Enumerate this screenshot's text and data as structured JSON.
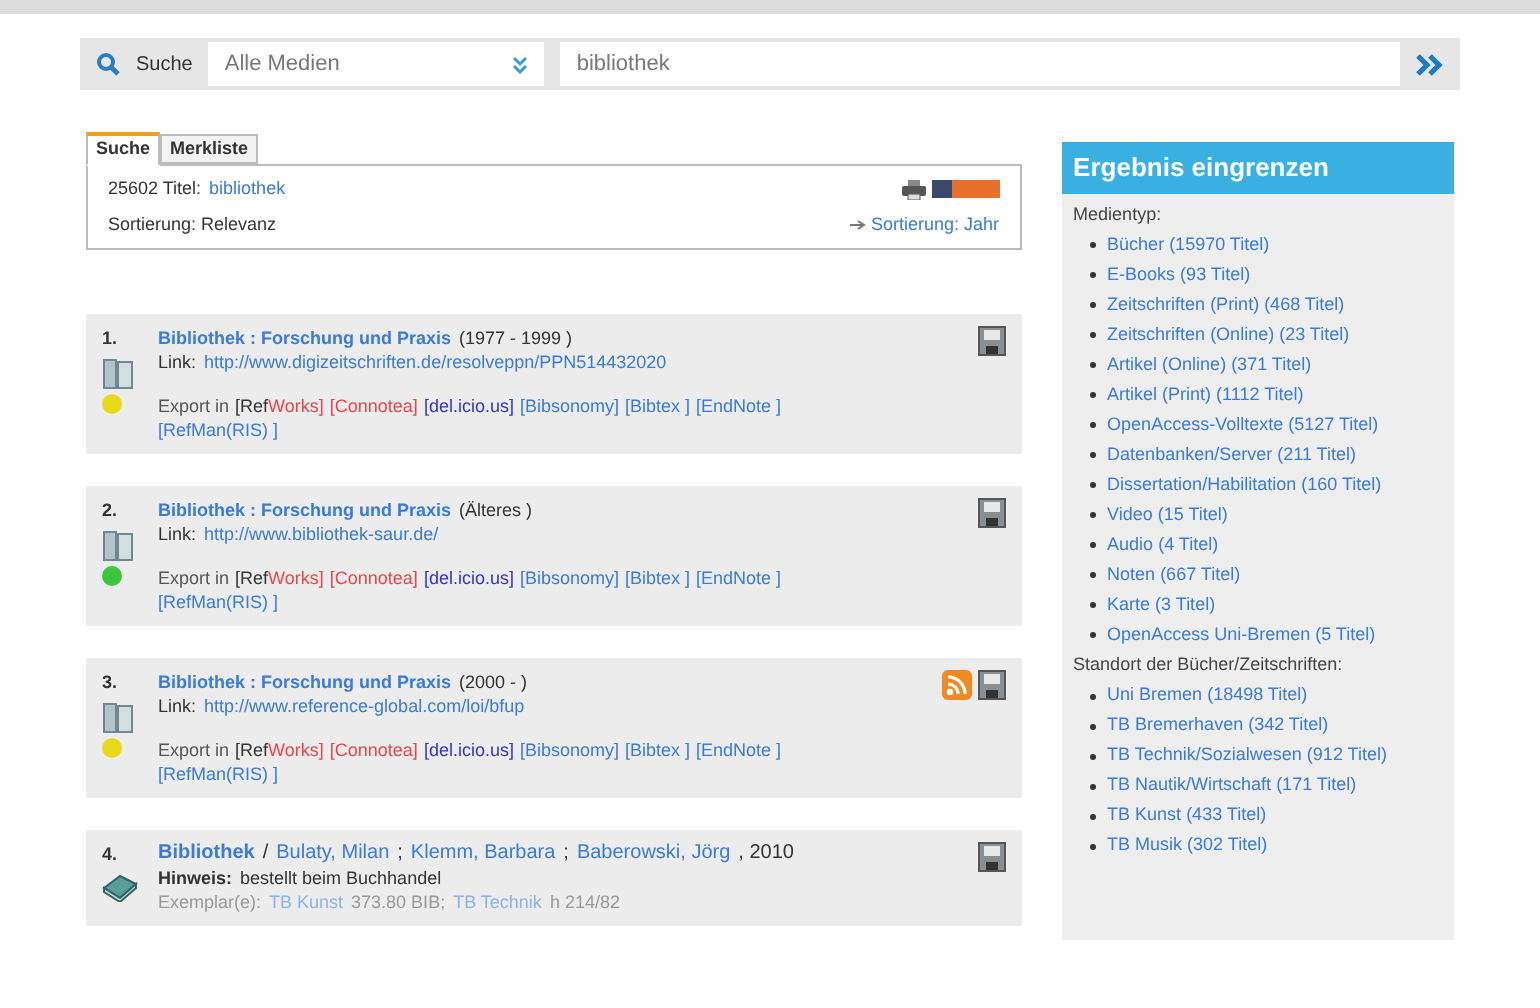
{
  "search_bar": {
    "label": "Suche",
    "media_select": "Alle Medien",
    "query": "bibliothek"
  },
  "tabs": [
    {
      "label": "Suche",
      "selected": true
    },
    {
      "label": "Merkliste",
      "selected": false
    }
  ],
  "summary": {
    "count": "25602 Titel:",
    "term": "bibliothek",
    "sort": "Sortierung: Relevanz",
    "sort_link": "Sortierung: Jahr"
  },
  "results": [
    {
      "number": "1.",
      "kind": "journal",
      "color": "#e8d81c",
      "title": "Bibliothek : Forschung und Praxis",
      "extra": "(1977 - 1999 )",
      "link_label": "Link:",
      "link": "http://www.digizeitschriften.de/resolveppn/PPN514432020",
      "rss": false,
      "export_label": "Export in",
      "exports": [
        {
          "prefix": "[Ref",
          "text": "Works]",
          "color": "#e8474a"
        },
        {
          "text": "[Connotea]",
          "color": "#e8474a"
        },
        {
          "text": "[del.icio.us]",
          "color": "#3333cc"
        },
        {
          "text": "[Bibsonomy]",
          "color": "#3a7bd5"
        },
        {
          "text": "[Bibtex ]",
          "color": "#3a7bd5"
        },
        {
          "text": "[EndNote ]",
          "color": "#3a7bd5"
        },
        {
          "text": "[RefMan(RIS) ]",
          "color": "#3a7bd5"
        }
      ]
    },
    {
      "number": "2.",
      "kind": "journal",
      "color": "#3cc43c",
      "title": "Bibliothek : Forschung und Praxis",
      "extra": "(Älteres )",
      "link_label": "Link:",
      "link": "http://www.bibliothek-saur.de/",
      "rss": false,
      "export_label": "Export in",
      "exports": [
        {
          "prefix": "[Ref",
          "text": "Works]",
          "color": "#e8474a"
        },
        {
          "text": "[Connotea]",
          "color": "#e8474a"
        },
        {
          "text": "[del.icio.us]",
          "color": "#3333cc"
        },
        {
          "text": "[Bibsonomy]",
          "color": "#3a7bd5"
        },
        {
          "text": "[Bibtex ]",
          "color": "#3a7bd5"
        },
        {
          "text": "[EndNote ]",
          "color": "#3a7bd5"
        },
        {
          "text": "[RefMan(RIS) ]",
          "color": "#3a7bd5"
        }
      ]
    },
    {
      "number": "3.",
      "kind": "journal",
      "color": "#e8d81c",
      "title": "Bibliothek : Forschung und Praxis",
      "extra": "(2000 - )",
      "link_label": "Link:",
      "link": "http://www.reference-global.com/loi/bfup",
      "rss": true,
      "export_label": "Export in",
      "exports": [
        {
          "prefix": "[Ref",
          "text": "Works]",
          "color": "#e8474a"
        },
        {
          "text": "[Connotea]",
          "color": "#e8474a"
        },
        {
          "text": "[del.icio.us]",
          "color": "#3333cc"
        },
        {
          "text": "[Bibsonomy]",
          "color": "#3a7bd5"
        },
        {
          "text": "[Bibtex ]",
          "color": "#3a7bd5"
        },
        {
          "text": "[EndNote ]",
          "color": "#3a7bd5"
        },
        {
          "text": "[RefMan(RIS) ]",
          "color": "#3a7bd5"
        }
      ]
    },
    {
      "number": "4.",
      "kind": "book",
      "title": "Bibliothek",
      "byline_sep": "/",
      "author_sep": ";",
      "authors": [
        "Bulaty, Milan",
        "Klemm, Barbara",
        "Baberowski, Jörg"
      ],
      "year": ", 2010",
      "note_label": "Hinweis:",
      "note": "bestellt beim Buchhandel",
      "copies_label": "Exemplar(e):",
      "copies": [
        {
          "place": "TB Kunst",
          "shelf": "373.80 BIB;"
        },
        {
          "place": "TB Technik",
          "shelf": "h 214/82"
        }
      ],
      "rss": false
    }
  ],
  "refine": {
    "title": "Ergebnis eingrenzen",
    "groups": [
      {
        "label": "Medientyp:",
        "items": [
          "Bücher (15970 Titel)",
          "E-Books (93 Titel)",
          "Zeitschriften (Print) (468 Titel)",
          "Zeitschriften (Online) (23 Titel)",
          "Artikel (Online) (371 Titel)",
          "Artikel (Print) (1112 Titel)",
          "OpenAccess-Volltexte (5127 Titel)",
          "Datenbanken/Server (211 Titel)",
          "Dissertation/Habilitation (160 Titel)",
          "Video (15 Titel)",
          "Audio (4 Titel)",
          "Noten (667 Titel)",
          "Karte (3 Titel)",
          "OpenAccess Uni-Bremen (5 Titel)"
        ]
      },
      {
        "label": "Standort der Bücher/Zeitschriften:",
        "items": [
          "Uni Bremen (18498 Titel)",
          "TB Bremerhaven (342 Titel)",
          "TB Technik/Sozialwesen (912 Titel)",
          "TB Nautik/Wirtschaft (171 Titel)",
          "TB Kunst (433 Titel)",
          "TB Musik (302 Titel)"
        ]
      }
    ]
  }
}
